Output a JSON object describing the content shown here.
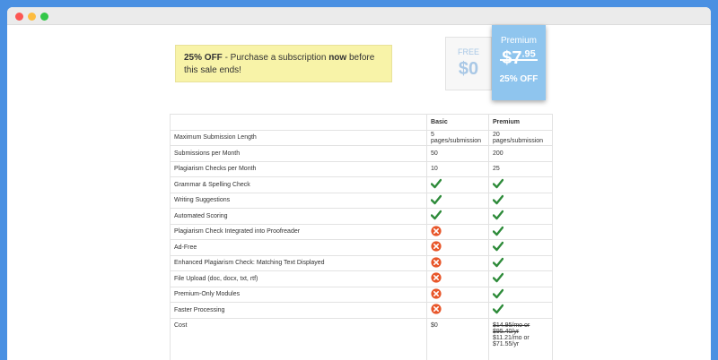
{
  "promo": {
    "discount": "25% OFF",
    "text_before": " - Purchase a subscription ",
    "emphasis": "now",
    "text_after": " before this sale ends!"
  },
  "plans": {
    "free": {
      "label": "FREE",
      "price": "$0"
    },
    "premium": {
      "label": "Premium",
      "price_old": "$7",
      "price_old_cents": ".95",
      "discount": "25% OFF"
    }
  },
  "table": {
    "headers": [
      "",
      "Basic",
      "Premium"
    ],
    "rows": [
      {
        "feature": "Maximum Submission Length",
        "basic": "5 pages/submission",
        "premium": "20 pages/submission"
      },
      {
        "feature": "Submissions per Month",
        "basic": "50",
        "premium": "200"
      },
      {
        "feature": "Plagiarism Checks per Month",
        "basic": "10",
        "premium": "25"
      },
      {
        "feature": "Grammar & Spelling Check",
        "basic_icon": "check-icon",
        "premium_icon": "check-icon"
      },
      {
        "feature": "Writing Suggestions",
        "basic_icon": "check-icon",
        "premium_icon": "check-icon"
      },
      {
        "feature": "Automated Scoring",
        "basic_icon": "check-icon",
        "premium_icon": "check-icon"
      },
      {
        "feature": "Plagiarism Check Integrated into Proofreader",
        "basic_icon": "x-icon",
        "premium_icon": "check-icon"
      },
      {
        "feature": "Ad-Free",
        "basic_icon": "x-icon",
        "premium_icon": "check-icon"
      },
      {
        "feature": "Enhanced Plagiarism Check: Matching Text Displayed",
        "basic_icon": "x-icon",
        "premium_icon": "check-icon"
      },
      {
        "feature": "File Upload (doc, docx, txt, rtf)",
        "basic_icon": "x-icon",
        "premium_icon": "check-icon"
      },
      {
        "feature": "Premium-Only Modules",
        "basic_icon": "x-icon",
        "premium_icon": "check-icon"
      },
      {
        "feature": "Faster Processing",
        "basic_icon": "x-icon",
        "premium_icon": "check-icon"
      }
    ],
    "cost": {
      "feature": "Cost",
      "basic": "$0",
      "premium_old": "$14.95/mo or $95.40/yr",
      "premium_new": "$11.21/mo or $71.55/yr"
    }
  },
  "colors": {
    "background": "#4a90e2",
    "premium": "#8fc5ee",
    "check": "#2e8b3a",
    "x": "#e8562a",
    "promo": "#f8f3a8"
  }
}
